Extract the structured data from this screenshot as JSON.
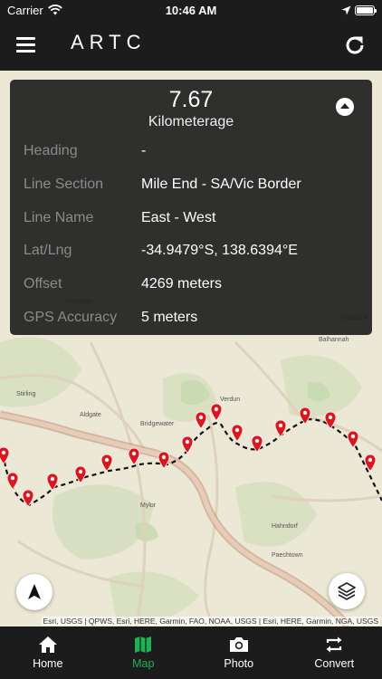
{
  "status_bar": {
    "carrier": "Carrier",
    "time": "10:46 AM",
    "battery_level": 1.0
  },
  "nav": {
    "logo": "ARTC",
    "menu_icon": "hamburger-icon",
    "refresh_icon": "refresh-icon"
  },
  "info_panel": {
    "kilometerage_value": "7.67",
    "kilometerage_label": "Kilometerage",
    "rows": [
      {
        "key": "Heading",
        "value": "-"
      },
      {
        "key": "Line Section",
        "value": "Mile End - SA/Vic Border"
      },
      {
        "key": "Line Name",
        "value": "East - West"
      },
      {
        "key": "Lat/Lng",
        "value": "-34.9479°S, 138.6394°E"
      },
      {
        "key": "Offset",
        "value": "4269 meters"
      },
      {
        "key": "GPS Accuracy",
        "value": "5 meters"
      }
    ]
  },
  "map": {
    "attribution": "Esri, USGS | QPWS, Esri, HERE, Garmin, FAO, NOAA, USGS | Esri, HERE, Garmin, NGA, USGS",
    "place_labels": [
      "Piccadilly",
      "Stirling",
      "Aldgate",
      "Bridgewater",
      "Verdun",
      "Balhannah",
      "Oakbank",
      "Hahndorf",
      "Mylor",
      "Paechtown"
    ],
    "marker_color": "#e3131b",
    "marker_count": 20
  },
  "tabs": [
    {
      "label": "Home",
      "icon": "home-icon",
      "active": false
    },
    {
      "label": "Map",
      "icon": "map-icon",
      "active": true
    },
    {
      "label": "Photo",
      "icon": "camera-icon",
      "active": false
    },
    {
      "label": "Convert",
      "icon": "convert-icon",
      "active": false
    }
  ],
  "colors": {
    "active_tab": "#1db354",
    "bar_background": "#1c1c1c"
  }
}
